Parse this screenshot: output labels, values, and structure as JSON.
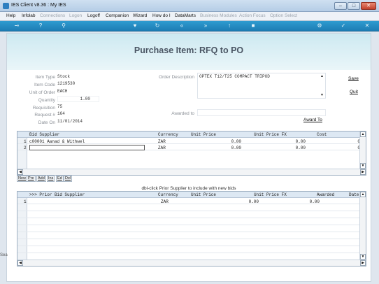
{
  "window": {
    "title": "IES Client v8.36 : My IES",
    "min": "–",
    "max": "□",
    "close": "✕"
  },
  "menu": [
    {
      "label": "Help",
      "dim": false
    },
    {
      "label": "Infolab",
      "dim": false
    },
    {
      "label": "Connections",
      "dim": true
    },
    {
      "label": "Logon",
      "dim": true
    },
    {
      "label": "Logoff",
      "dim": false
    },
    {
      "label": "Companion",
      "dim": false
    },
    {
      "label": "Wizard",
      "dim": false
    },
    {
      "label": "How do I",
      "dim": false
    },
    {
      "label": "DataMarts",
      "dim": false
    },
    {
      "label": "Business Modules",
      "dim": true
    },
    {
      "label": "Action Focus",
      "dim": true
    },
    {
      "label": "Option Select",
      "dim": true
    }
  ],
  "toolbar": [
    "key-icon",
    "help-icon",
    "search-icon",
    "heart-icon",
    "refresh-icon",
    "back-icon",
    "forward-icon",
    "up-icon",
    "stop-icon",
    "settings-icon",
    "check-icon",
    "close-icon"
  ],
  "page": {
    "title": "Purchase Item: RFQ to PO"
  },
  "form": {
    "item_type_label": "Item Type",
    "item_type": "Stock",
    "item_code_label": "Item Code",
    "item_code": "1219530",
    "unit_of_order_label": "Unit of Order",
    "unit_of_order": "EACH",
    "quantity_label": "Quantity",
    "quantity": "1.00",
    "requisition_label": "Requisition",
    "requisition": "75",
    "request_label": "Request #",
    "request": "164",
    "date_on_label": "Date On",
    "date_on": "11/01/2014",
    "order_description_label": "Order Description",
    "order_description": "OPTEX T12/T25 COMPACT TRIPOD",
    "awarded_to_label": "Awarded to",
    "awarded_to": ""
  },
  "links": {
    "save": "Save",
    "quit": "Quit",
    "award_to": "Award To"
  },
  "bids_grid": {
    "columns": [
      "Bid Supplier",
      "Currency",
      "Unit Price",
      "Unit Price FX",
      "Cost"
    ],
    "rows": [
      {
        "num": "1",
        "supplier": "c00001 Aanad & Withwel",
        "currency": "ZAR",
        "unit_price": "0.00",
        "unit_price_fx": "0.00",
        "cost": "0"
      },
      {
        "num": "2",
        "supplier": "",
        "currency": "ZAR",
        "unit_price": "0.00",
        "unit_price_fx": "0.00",
        "cost": "0"
      }
    ]
  },
  "grid_buttons": [
    "New",
    "Pre",
    "Add",
    "Ins",
    "Ed",
    "Del"
  ],
  "hint": "dbl-click Prior Supplier to include with new bids",
  "prior_grid": {
    "columns": [
      ">>> Prior Bid Supplier",
      "Currency",
      "Unit Price",
      "Unit Price FX",
      "Awarded",
      "Date"
    ],
    "rows": [
      {
        "num": "1",
        "supplier": "",
        "currency": "ZAR",
        "unit_price": "0.00",
        "unit_price_fx": "0.00",
        "awarded": "",
        "date": ""
      }
    ]
  },
  "side_fragment": "Sea"
}
